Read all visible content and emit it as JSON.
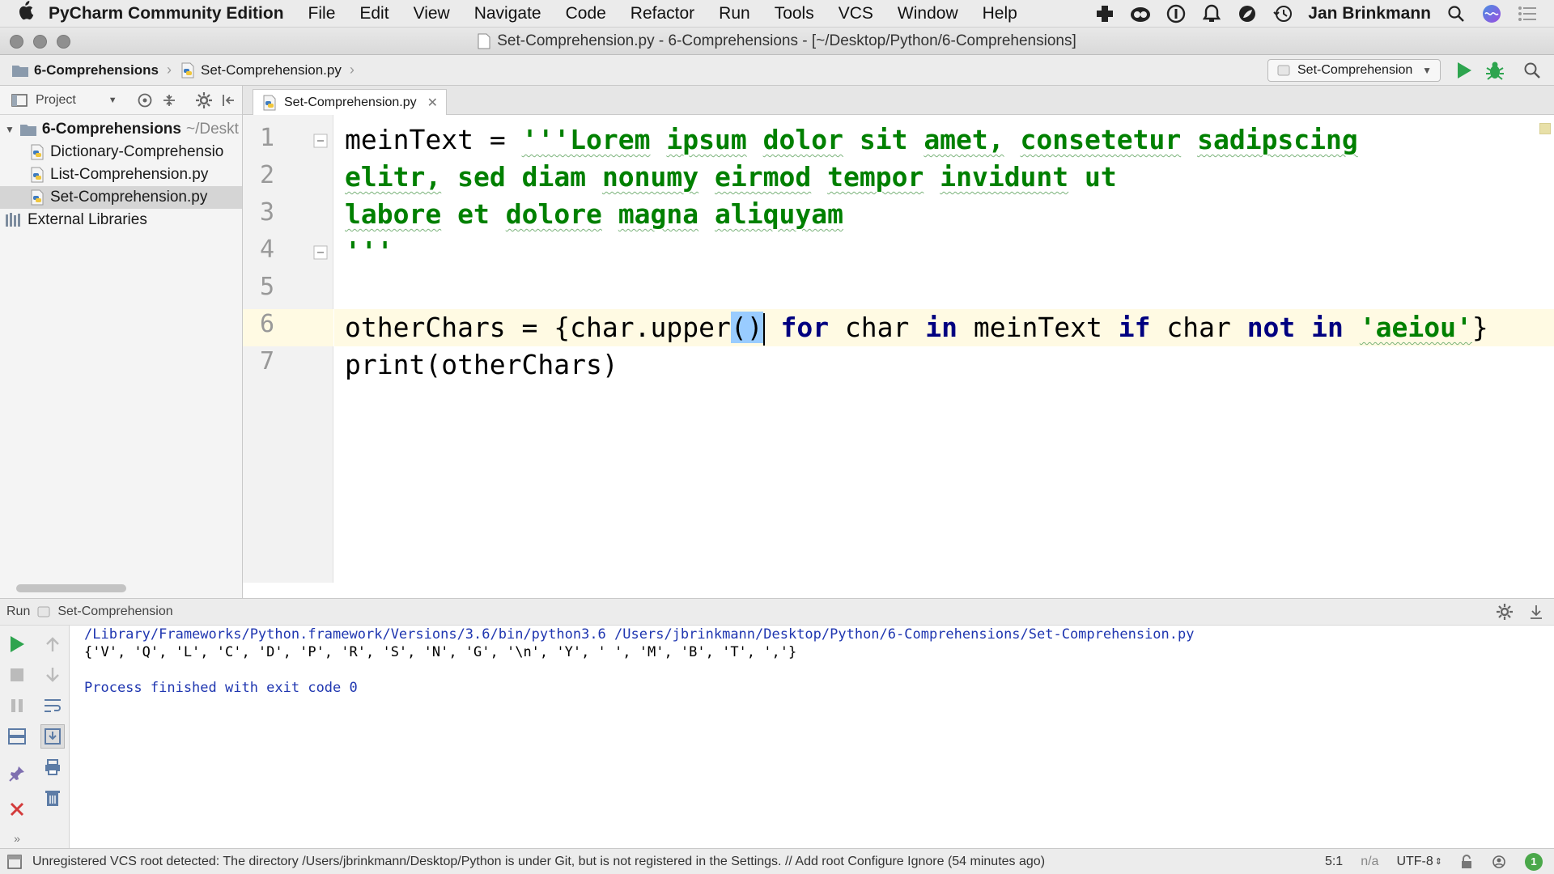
{
  "menubar": {
    "app_name": "PyCharm Community Edition",
    "items": [
      "File",
      "Edit",
      "View",
      "Navigate",
      "Code",
      "Refactor",
      "Run",
      "Tools",
      "VCS",
      "Window",
      "Help"
    ],
    "user": "Jan Brinkmann"
  },
  "window": {
    "title": "Set-Comprehension.py - 6-Comprehensions - [~/Desktop/Python/6-Comprehensions]"
  },
  "navbar": {
    "breadcrumb_project": "6-Comprehensions",
    "breadcrumb_file": "Set-Comprehension.py",
    "run_config": "Set-Comprehension"
  },
  "project_panel": {
    "label": "Project",
    "root": {
      "name": "6-Comprehensions",
      "path": "~/Deskt"
    },
    "files": [
      {
        "name": "Dictionary-Comprehensio",
        "selected": false
      },
      {
        "name": "List-Comprehension.py",
        "selected": false
      },
      {
        "name": "Set-Comprehension.py",
        "selected": true
      }
    ],
    "external": "External Libraries"
  },
  "editor": {
    "tab_label": "Set-Comprehension.py",
    "line_numbers": [
      "1",
      "2",
      "3",
      "4",
      "5",
      "6",
      "7"
    ],
    "lines": {
      "l1_var": "meinText",
      "l1_eq": " = ",
      "l1_str_words": [
        "'''Lorem",
        "ipsum",
        "dolor",
        "sit",
        "amet,",
        "consetetur",
        "sadipscing"
      ],
      "l2_words": [
        "elitr,",
        "sed",
        "diam",
        "nonumy",
        "eirmod",
        "tempor",
        "invidunt",
        "ut"
      ],
      "l3_words": [
        "labore",
        "et",
        "dolore",
        "magna",
        "aliquyam"
      ],
      "l4": "'''",
      "l6_a": "otherChars = {char.upper",
      "l6_paren": "()",
      "l6_b": " ",
      "l6_for": "for",
      "l6_c": " char ",
      "l6_in1": "in",
      "l6_d": " meinText ",
      "l6_if": "if",
      "l6_e": " char ",
      "l6_not": "not",
      "l6_f": " ",
      "l6_in2": "in",
      "l6_g": " ",
      "l6_str": "'aeiou'",
      "l6_h": "}",
      "l7": "print(otherChars)"
    }
  },
  "run_panel": {
    "label": "Run",
    "config": "Set-Comprehension",
    "console": {
      "command": "/Library/Frameworks/Python.framework/Versions/3.6/bin/python3.6 /Users/jbrinkmann/Desktop/Python/6-Comprehensions/Set-Comprehension.py",
      "output": "{'V', 'Q', 'L', 'C', 'D', 'P', 'R', 'S', 'N', 'G', '\\n', 'Y', ' ', 'M', 'B', 'T', ','}",
      "exit": "Process finished with exit code 0"
    }
  },
  "statusbar": {
    "message": "Unregistered VCS root detected: The directory /Users/jbrinkmann/Desktop/Python is under Git, but is not registered in the Settings. // Add root  Configure  Ignore (54 minutes ago)",
    "position": "5:1",
    "na": "n/a",
    "encoding": "UTF-8",
    "notifications": "1"
  },
  "colors": {
    "keyword": "#000080",
    "string": "#008000",
    "run_green": "#2da44e",
    "console_path": "#1f36b0"
  }
}
